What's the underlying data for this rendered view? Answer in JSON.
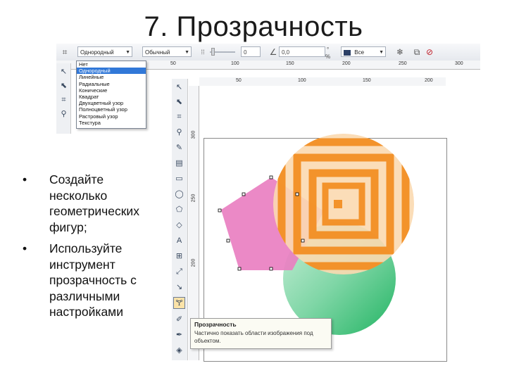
{
  "slide": {
    "title": "7. Прозрачность",
    "bullets": [
      "Создайте несколько геометрических фигур;",
      "Используйте инструмент прозрачность с различными настройками"
    ]
  },
  "property_bar": {
    "transparency_type": "Однородный",
    "merge_mode": "Обычный",
    "opacity_value": "0",
    "angle_value": "0,0",
    "target": "Все",
    "percent_sign": "%"
  },
  "transparency_dropdown": {
    "options": [
      "Нет",
      "Однородный",
      "Линейные",
      "Радиальные",
      "Конические",
      "Квадрат",
      "Двухцветный узор",
      "Полноцветный узор",
      "Растровый узор",
      "Текстура"
    ],
    "selected_index": 1
  },
  "ruler_top_outer": [
    "50",
    "100",
    "150",
    "200",
    "250",
    "300"
  ],
  "ruler_top_inner": [
    "50",
    "100",
    "150",
    "200"
  ],
  "ruler_left": [
    "300",
    "250",
    "200"
  ],
  "tooltip": {
    "title": "Прозрачность",
    "text": "Частично показать области изображения под объектом."
  },
  "colors": {
    "pentagon": "#e97fc1",
    "circle_green": "#3dbd77",
    "orange_stripes": "#f28c1e",
    "orange_light": "#fbd9b0"
  },
  "icons": {
    "pick_tool": "arrow-pointer",
    "shape_tool": "shape-edit",
    "crop_tool": "crop",
    "zoom_tool": "magnifier",
    "freehand_tool": "pencil",
    "smart_fill_tool": "smart-fill",
    "rectangle_tool": "rectangle",
    "ellipse_tool": "ellipse",
    "polygon_tool": "polygon",
    "basic_shapes_tool": "basic-shapes",
    "text_tool": "letter-a",
    "table_tool": "table",
    "dimension_tool": "dimension",
    "connector_tool": "connector",
    "interactive_tool": "blend",
    "transparency_tool": "wine-glass",
    "eyedropper_tool": "eyedropper",
    "outline_tool": "pen-nib",
    "fill_tool": "paint-bucket"
  }
}
